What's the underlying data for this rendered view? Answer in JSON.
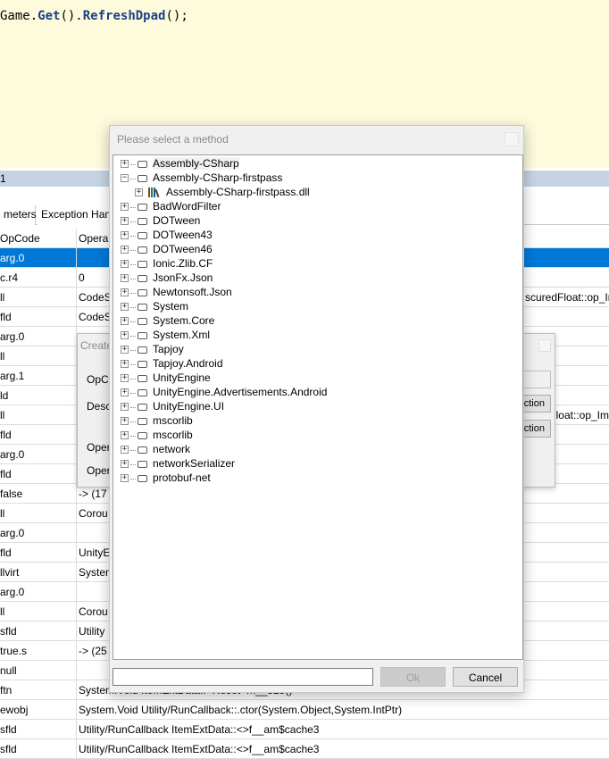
{
  "code": {
    "tokens": [
      {
        "text": "Game.",
        "kind": "default"
      },
      {
        "text": "Get",
        "kind": "method"
      },
      {
        "text": "().",
        "kind": "default"
      },
      {
        "text": "RefreshDpad",
        "kind": "method"
      },
      {
        "text": "();",
        "kind": "default"
      }
    ]
  },
  "panel": {
    "caption": "1"
  },
  "tabs": {
    "parameters": "meters",
    "exception_handlers": "Exception Han"
  },
  "grid": {
    "headers": {
      "opcode": "OpCode",
      "operand": "Opera"
    },
    "rows": [
      {
        "opcode": "arg.0",
        "operand": "",
        "selected": true
      },
      {
        "opcode": "c.r4",
        "operand": "0"
      },
      {
        "opcode": "ll",
        "operand": "CodeS",
        "tail": "scuredFloat::op_Im"
      },
      {
        "opcode": "fld",
        "operand": "CodeS"
      },
      {
        "opcode": "arg.0",
        "operand": ""
      },
      {
        "opcode": "ll",
        "operand": ""
      },
      {
        "opcode": "arg.1",
        "operand": ""
      },
      {
        "opcode": "ld",
        "operand": ""
      },
      {
        "opcode": "ll",
        "operand": "",
        "tail": "Float::op_Im"
      },
      {
        "opcode": "fld",
        "operand": ""
      },
      {
        "opcode": "arg.0",
        "operand": ""
      },
      {
        "opcode": "fld",
        "operand": ""
      },
      {
        "opcode": "false",
        "operand": "-> (17"
      },
      {
        "opcode": "ll",
        "operand": "Corou"
      },
      {
        "opcode": "arg.0",
        "operand": ""
      },
      {
        "opcode": "fld",
        "operand": "UnityE"
      },
      {
        "opcode": "llvirt",
        "operand": "System"
      },
      {
        "opcode": "arg.0",
        "operand": ""
      },
      {
        "opcode": "ll",
        "operand": "Corou"
      },
      {
        "opcode": "sfld",
        "operand": "Utility"
      },
      {
        "opcode": "true.s",
        "operand": "-> (25"
      },
      {
        "opcode": "null",
        "operand": ""
      },
      {
        "opcode": "ftn",
        "operand": "System.Void ItemExtData::<Reset>m__529()"
      },
      {
        "opcode": "ewobj",
        "operand": "System.Void Utility/RunCallback::.ctor(System.Object,System.IntPtr)"
      },
      {
        "opcode": "sfld",
        "operand": "Utility/RunCallback ItemExtData::<>f__am$cache3"
      },
      {
        "opcode": "sfld",
        "operand": "Utility/RunCallback ItemExtData::<>f__am$cache3"
      }
    ]
  },
  "create_dialog": {
    "title": "Create",
    "opcode_label": "OpCo",
    "description_label": "Descr",
    "operand_label_1": "Oper",
    "operand_label_2": "Oper",
    "button_1": "ction",
    "button_2": "ction"
  },
  "method_dialog": {
    "title": "Please select a method",
    "input_value": "",
    "ok_label": "Ok",
    "cancel_label": "Cancel",
    "tree": [
      {
        "label": "Assembly-CSharp",
        "expanded": false,
        "level": 0,
        "icon": "folder-icon",
        "highlight": true
      },
      {
        "label": "Assembly-CSharp-firstpass",
        "expanded": true,
        "level": 0,
        "icon": "folder-icon"
      },
      {
        "label": "Assembly-CSharp-firstpass.dll",
        "expanded": false,
        "level": 1,
        "icon": "library-icon"
      },
      {
        "label": "BadWordFilter",
        "expanded": false,
        "level": 0,
        "icon": "folder-icon"
      },
      {
        "label": "DOTween",
        "expanded": false,
        "level": 0,
        "icon": "folder-icon"
      },
      {
        "label": "DOTween43",
        "expanded": false,
        "level": 0,
        "icon": "folder-icon"
      },
      {
        "label": "DOTween46",
        "expanded": false,
        "level": 0,
        "icon": "folder-icon"
      },
      {
        "label": "Ionic.Zlib.CF",
        "expanded": false,
        "level": 0,
        "icon": "folder-icon"
      },
      {
        "label": "JsonFx.Json",
        "expanded": false,
        "level": 0,
        "icon": "folder-icon"
      },
      {
        "label": "Newtonsoft.Json",
        "expanded": false,
        "level": 0,
        "icon": "folder-icon"
      },
      {
        "label": "System",
        "expanded": false,
        "level": 0,
        "icon": "folder-icon"
      },
      {
        "label": "System.Core",
        "expanded": false,
        "level": 0,
        "icon": "folder-icon"
      },
      {
        "label": "System.Xml",
        "expanded": false,
        "level": 0,
        "icon": "folder-icon"
      },
      {
        "label": "Tapjoy",
        "expanded": false,
        "level": 0,
        "icon": "folder-icon"
      },
      {
        "label": "Tapjoy.Android",
        "expanded": false,
        "level": 0,
        "icon": "folder-icon"
      },
      {
        "label": "UnityEngine",
        "expanded": false,
        "level": 0,
        "icon": "folder-icon"
      },
      {
        "label": "UnityEngine.Advertisements.Android",
        "expanded": false,
        "level": 0,
        "icon": "folder-icon"
      },
      {
        "label": "UnityEngine.UI",
        "expanded": false,
        "level": 0,
        "icon": "folder-icon"
      },
      {
        "label": "mscorlib",
        "expanded": false,
        "level": 0,
        "icon": "folder-icon"
      },
      {
        "label": "mscorlib",
        "expanded": false,
        "level": 0,
        "icon": "folder-icon"
      },
      {
        "label": "network",
        "expanded": false,
        "level": 0,
        "icon": "folder-icon"
      },
      {
        "label": "networkSerializer",
        "expanded": false,
        "level": 0,
        "icon": "folder-icon"
      },
      {
        "label": "protobuf-net",
        "expanded": false,
        "level": 0,
        "icon": "folder-icon"
      }
    ]
  },
  "colors": {
    "code_background": "#fdfbdc",
    "method_token": "#1d3f86",
    "selection": "#0078d7",
    "panel_caption": "#c5d3e2"
  }
}
